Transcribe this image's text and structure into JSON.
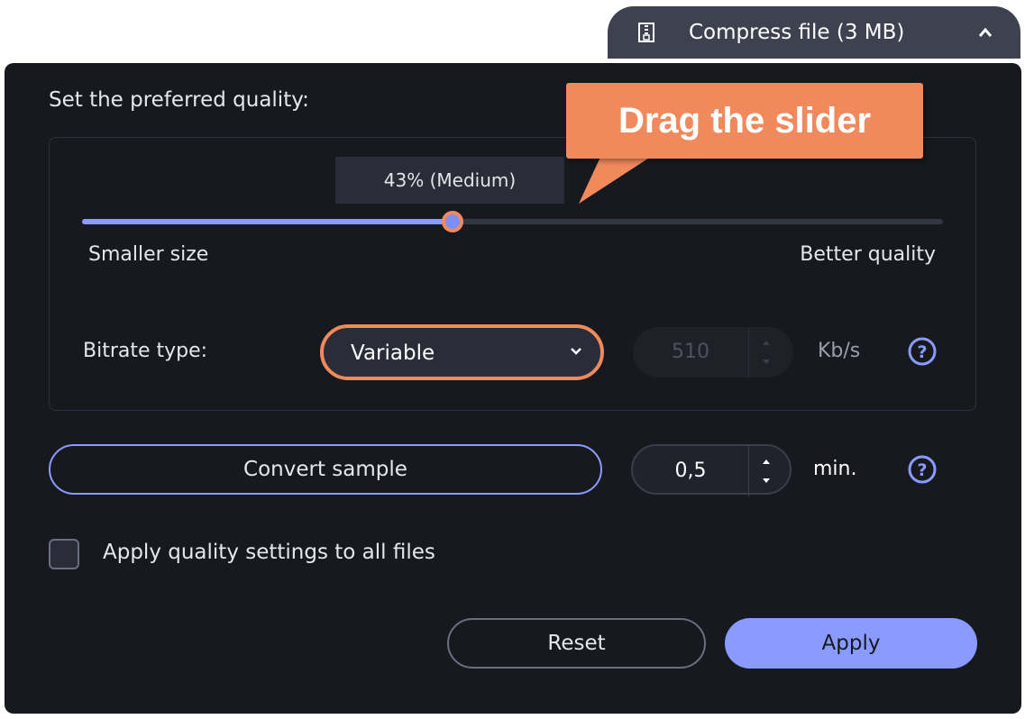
{
  "top_tab": {
    "label": "Compress file (3 MB)",
    "icon": "zip-file-icon",
    "collapse_icon": "chevron-up-icon"
  },
  "dialog": {
    "title": "Set the preferred quality:",
    "quality": {
      "value_label": "43% (Medium)",
      "value_percent": 43,
      "min_label": "Smaller size",
      "max_label": "Better quality"
    },
    "bitrate": {
      "label": "Bitrate type:",
      "selected": "Variable",
      "value": "510",
      "unit": "Kb/s",
      "disabled": true
    },
    "sample": {
      "button_label": "Convert sample",
      "duration": "0,5",
      "unit": "min."
    },
    "apply_all": {
      "label": "Apply quality settings to all files",
      "checked": false
    },
    "buttons": {
      "reset": "Reset",
      "apply": "Apply"
    }
  },
  "annotation": {
    "text": "Drag the slider"
  },
  "colors": {
    "dialog_bg": "#17191f",
    "accent": "#8a9bff",
    "highlight": "#f08a5d",
    "tab_bg": "#3d4150"
  }
}
